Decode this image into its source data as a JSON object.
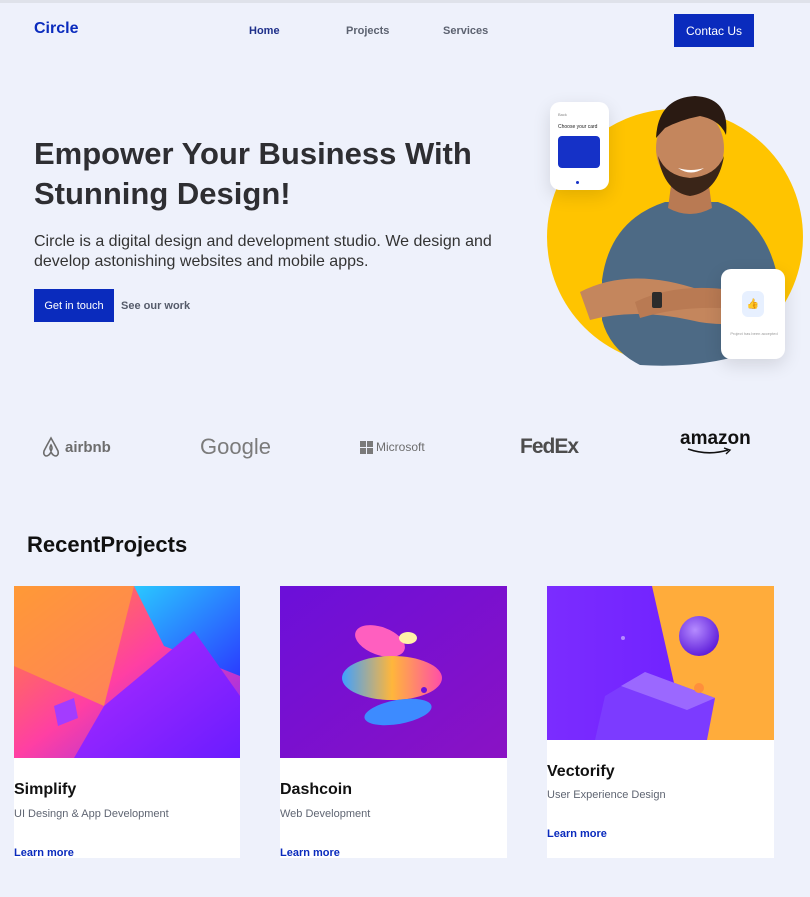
{
  "nav": {
    "logo": "Circle",
    "links": [
      "Home",
      "Projects",
      "Services"
    ],
    "contact_label": "Contac Us"
  },
  "hero": {
    "title_line1": "Empower Your Business With",
    "title_line2": "Stunning Design!",
    "description": "Circle is a digital design and development studio. We design and develop astonishing websites and mobile apps.",
    "primary_cta": "Get in touch",
    "secondary_cta": "See our work",
    "card_top": {
      "small_label": "Back",
      "heading": "Choose your card"
    },
    "card_bottom": {
      "caption": "Project has been accepted"
    }
  },
  "brands": [
    "airbnb",
    "Google",
    "Microsoft",
    "FedEx",
    "amazon"
  ],
  "projects": {
    "title": "RecentProjects",
    "items": [
      {
        "name": "Simplify",
        "category": "UI Desingn & App Development",
        "link": "Learn more"
      },
      {
        "name": "Dashcoin",
        "category": "Web Development",
        "link": "Learn more"
      },
      {
        "name": "Vectorify",
        "category": "User Experience Design",
        "link": "Learn more"
      }
    ]
  },
  "colors": {
    "brand_blue": "#0a2bbd",
    "page_bg": "#eef1fb",
    "accent_yellow": "#ffc400"
  }
}
